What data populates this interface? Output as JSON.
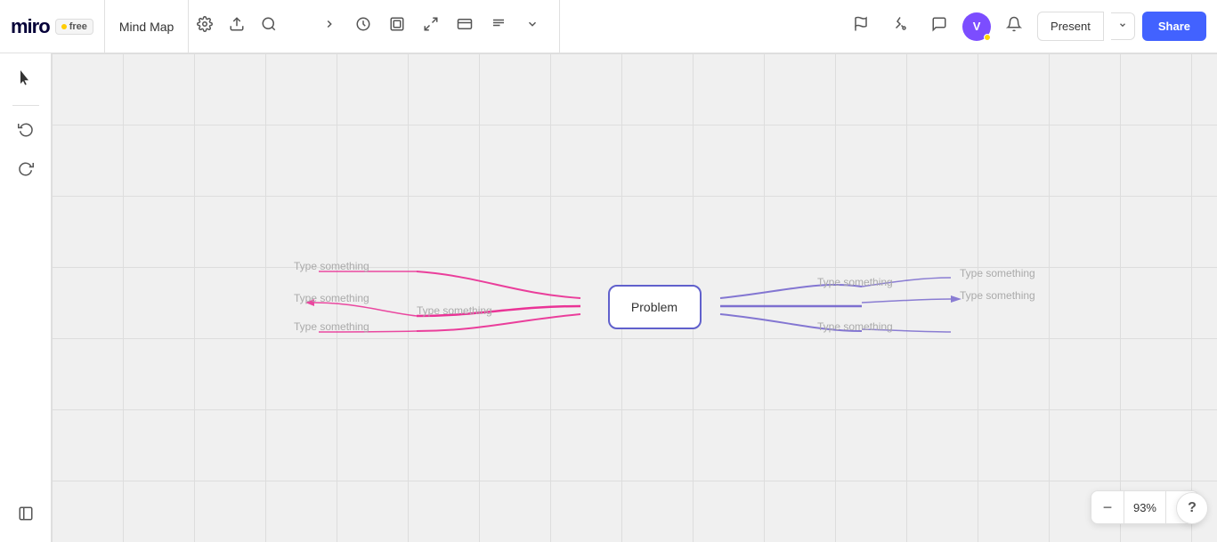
{
  "header": {
    "logo": "miro",
    "free_label": "free",
    "board_name": "Mind Map",
    "present_label": "Present",
    "share_label": "Share",
    "zoom_level": "93%"
  },
  "toolbar_left": {
    "settings_icon": "⚙",
    "upload_icon": "↑",
    "search_icon": "🔍",
    "collapse_icon": "❯"
  },
  "toolbar_center": {
    "timer_icon": "◎",
    "frames_icon": "▣",
    "fullscreen_icon": "⛶",
    "reactions_icon": "🔖",
    "notes_icon": "≡",
    "more_icon": "⌄"
  },
  "toolbar_right": {
    "flag_icon": "⚑",
    "laser_icon": "✱",
    "comment_icon": "💬",
    "avatar_initials": "V",
    "bell_icon": "🔔"
  },
  "side_panel": {
    "cursor_icon": "↖",
    "undo_icon": "↺",
    "redo_icon": "↻",
    "panel_icon": "▣"
  },
  "canvas": {
    "center_node_text": "Problem",
    "left_branches": [
      {
        "label1": "Type something",
        "label2": "Type something",
        "label3": "Type something",
        "label4": "Type something"
      }
    ],
    "right_branches": [
      {
        "label1": "Type something",
        "label2": "Type something",
        "label3": "Type something"
      }
    ]
  },
  "zoom": {
    "minus_label": "−",
    "level": "93%",
    "plus_label": "+"
  }
}
